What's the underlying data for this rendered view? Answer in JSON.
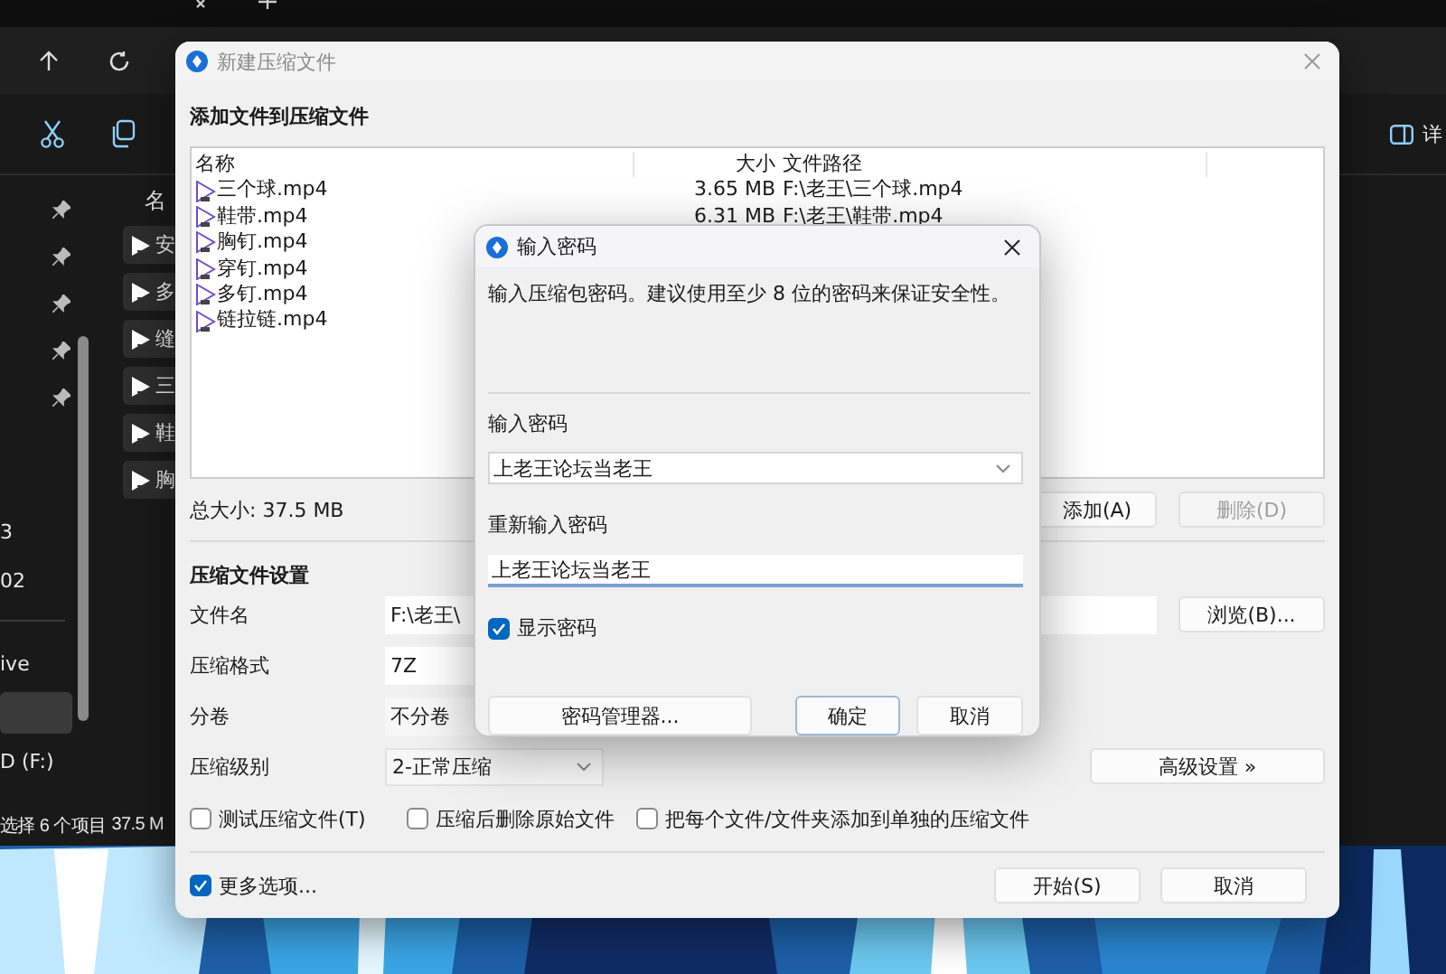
{
  "explorer": {
    "column_header": "名",
    "files": [
      {
        "label": "安"
      },
      {
        "label": "多"
      },
      {
        "label": "缝"
      },
      {
        "label": "三"
      },
      {
        "label": "鞋"
      },
      {
        "label": "胸"
      }
    ],
    "sidebar_items": [
      {
        "label": "3",
        "selected": false
      },
      {
        "label": "02",
        "selected": false
      },
      {
        "label": "ive",
        "selected": false
      },
      {
        "selected": true
      },
      {
        "label": "D (F:)",
        "selected": false
      }
    ],
    "details_label": "详",
    "status": {
      "selection": "选择 6 个项目",
      "size": "37.5 M"
    }
  },
  "archive_dialog": {
    "title": "新建压缩文件",
    "heading": "添加文件到压缩文件",
    "columns": [
      "名称",
      "大小",
      "文件路径"
    ],
    "files": [
      {
        "name": "三个球.mp4",
        "size": "3.65 MB",
        "path": "F:\\老王\\三个球.mp4"
      },
      {
        "name": "鞋带.mp4",
        "size": "6.31 MB",
        "path": "F:\\老王\\鞋带.mp4"
      },
      {
        "name": "胸钉.mp4"
      },
      {
        "name": "穿钉.mp4"
      },
      {
        "name": "多钉.mp4"
      },
      {
        "name": "链拉链.mp4"
      }
    ],
    "total": "总大小: 37.5 MB",
    "list_buttons": [
      {
        "label": "添加(A)",
        "disabled": false
      },
      {
        "label": "删除(D)",
        "disabled": true
      }
    ],
    "settings_heading": "压缩文件设置",
    "fields": [
      {
        "label": "文件名",
        "kind": "text",
        "value": "F:\\老王\\"
      },
      {
        "label": "压缩格式",
        "kind": "text",
        "value": "7Z"
      },
      {
        "label": "分卷",
        "kind": "select",
        "value": "不分卷"
      },
      {
        "label": "压缩级别",
        "kind": "dropdown",
        "value": "2-正常压缩"
      }
    ],
    "browse_button": "浏览(B)...",
    "advanced_button": "高级设置 »",
    "options": [
      {
        "label": "测试压缩文件(T)",
        "checked": false
      },
      {
        "label": "压缩后删除原始文件",
        "checked": false
      },
      {
        "label": "把每个文件/文件夹添加到单独的压缩文件",
        "checked": false
      }
    ],
    "more_options": {
      "label": "更多选项...",
      "checked": true
    },
    "buttons": [
      {
        "label": "开始(S)"
      },
      {
        "label": "取消"
      }
    ]
  },
  "password_dialog": {
    "title": "输入密码",
    "message": "输入压缩包密码。建议使用至少 8 位的密码来保证安全性。",
    "password": {
      "label": "输入密码",
      "value": "上老王论坛当老王"
    },
    "confirm": {
      "label": "重新输入密码",
      "value": "上老王论坛当老王"
    },
    "show_password": {
      "label": "显示密码",
      "checked": true
    },
    "buttons": [
      {
        "label": "密码管理器...",
        "focused": false
      },
      {
        "label": "确定",
        "focused": true
      },
      {
        "label": "取消",
        "focused": false
      }
    ]
  }
}
